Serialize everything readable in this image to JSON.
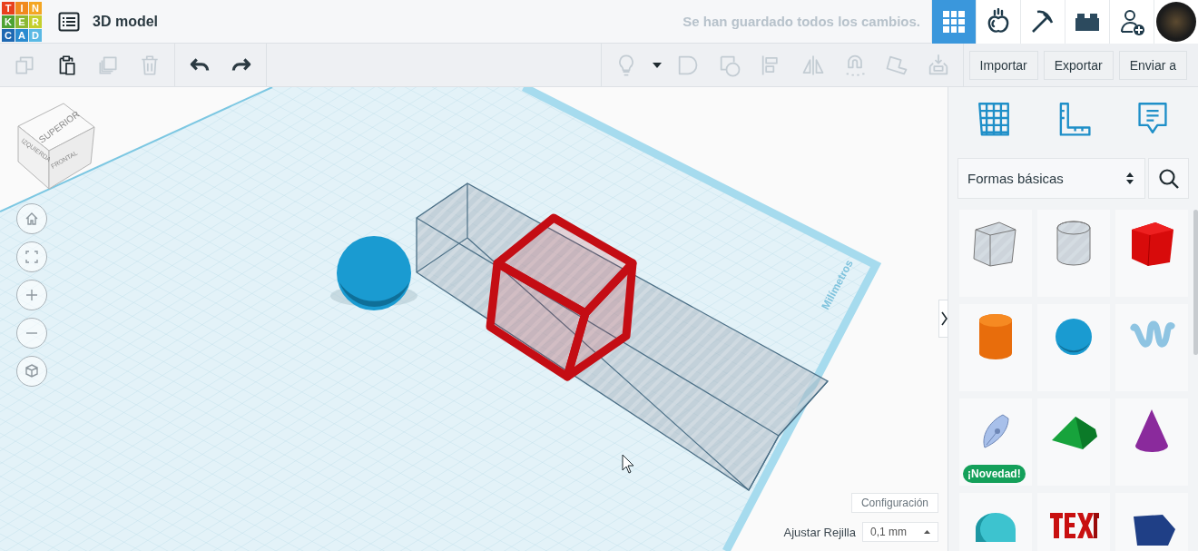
{
  "logo": {
    "letters": [
      {
        "char": "T",
        "color": "#e8401d"
      },
      {
        "char": "I",
        "color": "#f0891e"
      },
      {
        "char": "N",
        "color": "#f4a623"
      },
      {
        "char": "K",
        "color": "#4da232"
      },
      {
        "char": "E",
        "color": "#8ab833"
      },
      {
        "char": "R",
        "color": "#c4cf2c"
      },
      {
        "char": "C",
        "color": "#1e68b2"
      },
      {
        "char": "A",
        "color": "#2a8bd0"
      },
      {
        "char": "D",
        "color": "#5ab9e4"
      }
    ]
  },
  "title": "3D model",
  "save_status": "Se han guardado todos los cambios.",
  "nav": [
    {
      "kind": "grid",
      "selected": true
    },
    {
      "kind": "tinker",
      "selected": false
    },
    {
      "kind": "pickaxe",
      "selected": false
    },
    {
      "kind": "brick",
      "selected": false
    },
    {
      "kind": "add-user",
      "selected": false
    },
    {
      "kind": "avatar",
      "selected": false
    }
  ],
  "toolbar": {
    "left": [
      {
        "kind": "copy",
        "disabled": true
      },
      {
        "kind": "paste",
        "disabled": false
      },
      {
        "kind": "duplicate",
        "disabled": true
      },
      {
        "kind": "delete",
        "disabled": true
      },
      {
        "kind": "undo",
        "disabled": false
      },
      {
        "kind": "redo",
        "disabled": false
      }
    ],
    "right": [
      {
        "kind": "bulb",
        "disabled": true
      },
      {
        "kind": "caret",
        "disabled": false
      },
      {
        "kind": "solid",
        "disabled": true
      },
      {
        "kind": "hole",
        "disabled": true
      },
      {
        "kind": "align",
        "disabled": true
      },
      {
        "kind": "mirror",
        "disabled": true
      },
      {
        "kind": "magnet",
        "disabled": true
      },
      {
        "kind": "workplane",
        "disabled": true
      },
      {
        "kind": "drop",
        "disabled": true
      }
    ],
    "buttons": [
      "Importar",
      "Exportar",
      "Enviar a"
    ]
  },
  "view_cube": {
    "top": "SUPERIOR",
    "left": "IZQUIERDA",
    "front": "FRONTAL"
  },
  "view_controls": [
    {
      "kind": "home"
    },
    {
      "kind": "fit"
    },
    {
      "kind": "zoom-in"
    },
    {
      "kind": "zoom-out"
    },
    {
      "kind": "ortho"
    }
  ],
  "workplane": {
    "unit_label": "Milímetros"
  },
  "settings_button": "Configuración",
  "snap_grid": {
    "label": "Ajustar Rejilla",
    "value": "0,1 mm"
  },
  "panel": {
    "tools": [
      {
        "kind": "workplane"
      },
      {
        "kind": "ruler"
      },
      {
        "kind": "note"
      }
    ],
    "category": "Formas básicas",
    "shapes": [
      {
        "kind": "box-hole"
      },
      {
        "kind": "cylinder-hole"
      },
      {
        "kind": "box"
      },
      {
        "kind": "cylinder"
      },
      {
        "kind": "sphere"
      },
      {
        "kind": "scribble"
      },
      {
        "kind": "nib",
        "badge": "¡Novedad!"
      },
      {
        "kind": "roof"
      },
      {
        "kind": "cone"
      },
      {
        "kind": "round-roof"
      },
      {
        "kind": "text"
      },
      {
        "kind": "polygon"
      }
    ]
  }
}
